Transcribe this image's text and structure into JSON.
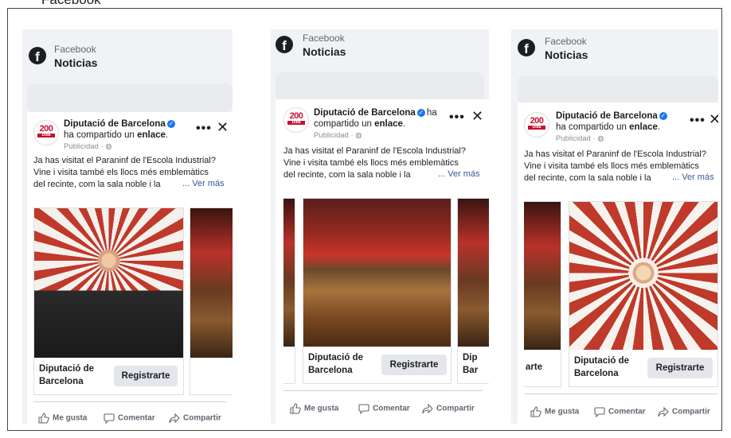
{
  "caption": "Facebook",
  "panels": [
    {
      "app_name": "Facebook",
      "section_title": "Noticias",
      "author_name": "Diputació de Barcelona",
      "shared_text": "ha compartido un",
      "shared_link": "enlace",
      "meta": "Publicidad · ",
      "body_lines": [
        "Ja has visitat el Paraninf de l'Escola Industrial?",
        "Vine i visita també els llocs més emblemàtics",
        "del recinte, com la sala noble i la"
      ],
      "see_more": "... Ver más",
      "slide_label_1": "Diputació de",
      "slide_label_2": "Barcelona",
      "cta": "Registrarte",
      "actions": [
        "Me gusta",
        "Comentar",
        "Compartir"
      ]
    },
    {
      "app_name": "Facebook",
      "section_title": "Noticias",
      "author_name": "Diputació de Barcelona",
      "shared_text": "ha compartido un",
      "shared_link": "enlace",
      "meta": "Publicidad · ",
      "body_lines": [
        "Ja has visitat el Paraninf de l'Escola Industrial?",
        "Vine i visita també els llocs més emblemàtics",
        "del recinte, com la sala noble i la"
      ],
      "see_more": "... Ver más",
      "slide_label_1": "Diputació de",
      "slide_label_2": "Barcelona",
      "next_label_1": "Dip",
      "next_label_2": "Bar",
      "cta": "Registrarte",
      "actions": [
        "Me gusta",
        "Comentar",
        "Compartir"
      ]
    },
    {
      "app_name": "Facebook",
      "section_title": "Noticias",
      "author_name": "Diputació de Barcelona",
      "shared_text": "ha compartido un",
      "shared_link": "enlace",
      "meta": "Publicidad · ",
      "body_lines": [
        "Ja has visitat el Paraninf de l'Escola Industrial?",
        "Vine i visita també els llocs més emblemàtics",
        "del recinte, com la sala noble i la"
      ],
      "see_more": "... Ver más",
      "prev_label": "arte",
      "slide_label_1": "Diputació de",
      "slide_label_2": "Barcelona",
      "cta": "Registrarte",
      "actions": [
        "Me gusta",
        "Comentar",
        "Compartir"
      ]
    }
  ],
  "avatar": {
    "number": "200",
    "sub": "Diba"
  },
  "icons": [
    "facebook-logo-icon",
    "verified-badge-icon",
    "globe-icon",
    "more-options-icon",
    "close-icon",
    "like-icon",
    "comment-icon",
    "share-icon"
  ],
  "colors": {
    "facebook_blue": "#1877f2",
    "diba_red": "#c8102e",
    "panel_bg": "#f0f2f5"
  }
}
